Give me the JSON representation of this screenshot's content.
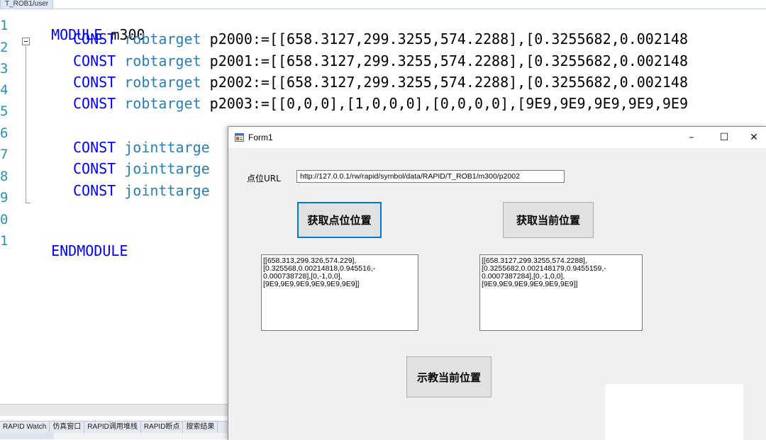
{
  "editor": {
    "tab_label": "T_ROB1/user",
    "line_numbers": [
      "1",
      "2",
      "3",
      "4",
      "5",
      "6",
      "7",
      "8",
      "9",
      "0",
      "1"
    ],
    "module_keyword": "MODULE",
    "module_name": "m300",
    "const_keyword": "CONST",
    "robtarget_type": "robtarget",
    "jointtarget_type": "jointtarge",
    "robtarget_lines": [
      " p2000:=[[658.3127,299.3255,574.2288],[0.3255682,0.002148",
      " p2001:=[[658.3127,299.3255,574.2288],[0.3255682,0.002148",
      " p2002:=[[658.3127,299.3255,574.2288],[0.3255682,0.002148",
      " p2003:=[[0,0,0],[1,0,0,0],[0,0,0,0],[9E9,9E9,9E9,9E9,9E9"
    ],
    "endmodule_keyword": "ENDMODULE"
  },
  "bottom_tabs": [
    "RAPID Watch",
    "仿真窗口",
    "RAPID调用堆栈",
    "RAPID断点",
    "搜索结果"
  ],
  "form": {
    "title": "Form1",
    "caption_buttons": {
      "minimize": "–",
      "maximize": "☐",
      "close": "✕"
    },
    "url_label": "点位URL",
    "url_value": "http://127.0.0.1/rw/rapid/symbol/data/RAPID/T_ROB1/m300/p2002",
    "btn_get_point": "获取点位位置",
    "btn_get_current": "获取当前位置",
    "btn_teach": "示教当前位置",
    "textbox_left": "[[658.313,299.326,574.229],\n[0.325568,0.00214818,0.945516,-\n0.000738728],[0,-1,0,0],\n[9E9,9E9,9E9,9E9,9E9,9E9]]",
    "textbox_right": "[[658.3127,299.3255,574.2288],\n[0.3255682,0.002148179,0.9455159,-\n0.0007387284],[0,-1,0,0],\n[9E9,9E9,9E9,9E9,9E9,9E9]]"
  },
  "colors": {
    "keyword": "#0000ff",
    "type": "#2b7fb0",
    "line_number": "#2b91af",
    "focus_border": "#0078d7"
  }
}
